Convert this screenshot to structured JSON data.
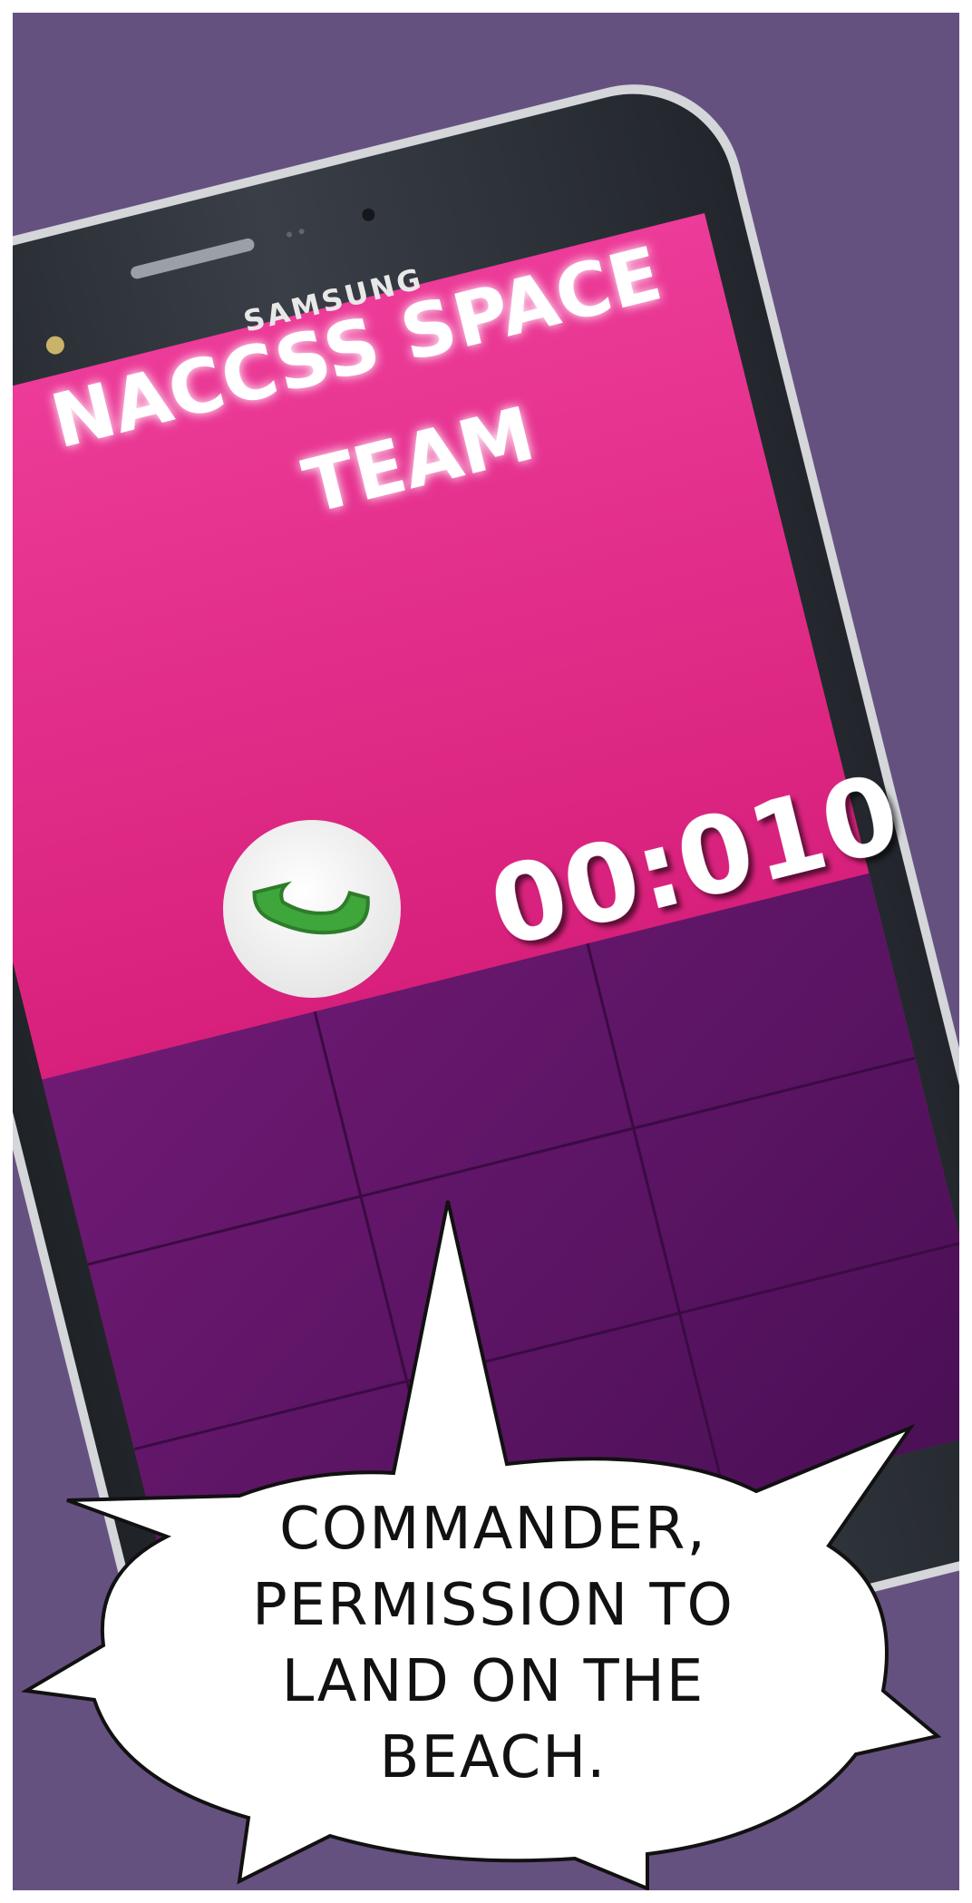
{
  "phone": {
    "brand": "SAMSUNG",
    "screen_title_line1": "NACCSS SPACE",
    "screen_title_line2": "TEAM",
    "call_timer": "00:010",
    "answer_icon": "phone-handset-icon"
  },
  "speech_bubble": {
    "line1": "COMMANDER,",
    "line2": "PERMISSION TO",
    "line3": "LAND ON THE",
    "line4": "BEACH."
  },
  "colors": {
    "background": "#65517f",
    "screen_pink": "#e0207f",
    "screen_purple": "#5e1667",
    "phone_body": "#2b2f36",
    "call_green": "#3ea63a"
  }
}
